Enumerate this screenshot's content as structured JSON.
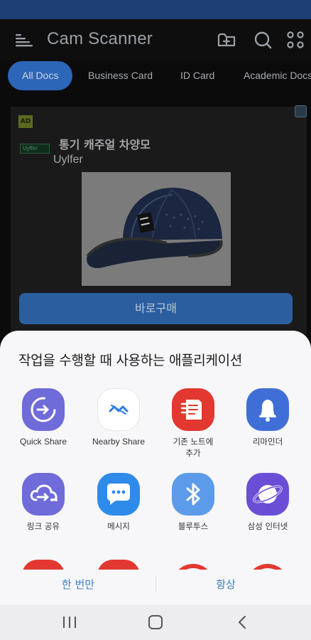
{
  "app": {
    "title": "Cam Scanner"
  },
  "header_icons": [
    "add-folder-icon",
    "search-icon",
    "scan-icon"
  ],
  "tabs": [
    {
      "label": "All Docs",
      "active": true
    },
    {
      "label": "Business Card",
      "active": false
    },
    {
      "label": "ID Card",
      "active": false
    },
    {
      "label": "Academic Docs",
      "active": false
    }
  ],
  "ad": {
    "badge": "AD",
    "logo_text": "Uylfer",
    "title": "통기 캐주얼 차양모",
    "brand": "Uylfer",
    "cta": "바로구매"
  },
  "share_sheet": {
    "title": "작업을 수행할 때 사용하는 애플리케이션",
    "apps": [
      {
        "label": "Quick Share",
        "icon": "quick-share-icon",
        "color": "#6f6bd8"
      },
      {
        "label": "Nearby Share",
        "icon": "nearby-share-icon",
        "color": "#ffffff"
      },
      {
        "label": "기존 노트에\n추가",
        "icon": "notes-icon",
        "color": "#e2382f"
      },
      {
        "label": "리마인더",
        "icon": "reminder-bell-icon",
        "color": "#3f6fd6"
      },
      {
        "label": "링크 공유",
        "icon": "link-share-cloud-icon",
        "color": "#6f6bd8"
      },
      {
        "label": "메시지",
        "icon": "messages-icon",
        "color": "#2f8bea"
      },
      {
        "label": "블루투스",
        "icon": "bluetooth-icon",
        "color": "#5b9bea"
      },
      {
        "label": "삼성 인터넷",
        "icon": "samsung-internet-icon",
        "color": "#6a4fd6"
      }
    ],
    "just_once": "한 번만",
    "always": "항상"
  },
  "nav": [
    "recent-apps-icon",
    "home-icon",
    "back-icon"
  ]
}
